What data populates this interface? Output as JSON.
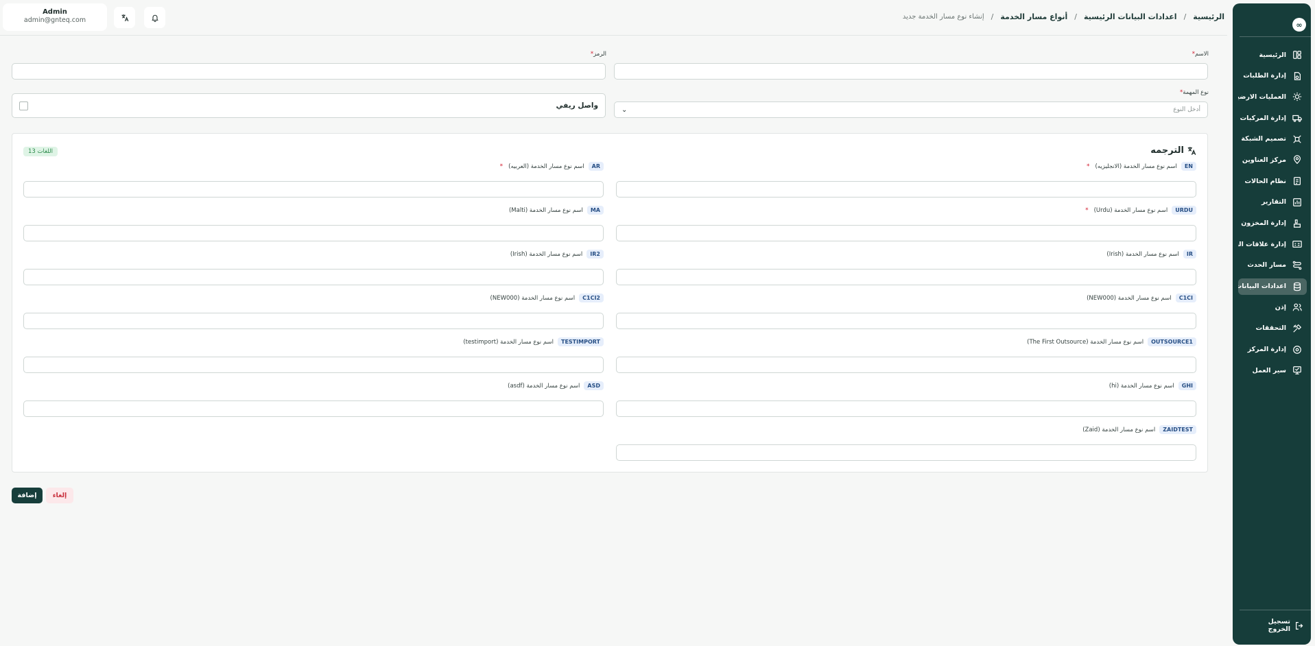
{
  "sidebar": {
    "logo": "∞",
    "items": [
      {
        "label": "الرئيسية",
        "icon": "layout-icon"
      },
      {
        "label": "إدارة الطلبات",
        "icon": "orders-icon"
      },
      {
        "label": "العمليات الارضية",
        "icon": "ground-ops-icon"
      },
      {
        "label": "إدارة المركبات",
        "icon": "truck-icon"
      },
      {
        "label": "تصميم الشبكة",
        "icon": "network-icon"
      },
      {
        "label": "مركز العناوين",
        "icon": "address-icon"
      },
      {
        "label": "نظام الحالات",
        "icon": "status-icon"
      },
      {
        "label": "التقارير",
        "icon": "reports-icon"
      },
      {
        "label": "إدارة المخزون",
        "icon": "inventory-icon"
      },
      {
        "label": "إدارة علاقات العملاء",
        "icon": "crm-icon"
      },
      {
        "label": "مسار الحدث",
        "icon": "route-icon"
      },
      {
        "label": "اعدادات البيانات",
        "icon": "database-icon",
        "active": true
      },
      {
        "label": "إذن",
        "icon": "users-icon"
      },
      {
        "label": "التحققات",
        "icon": "tools-icon"
      },
      {
        "label": "إدارة المركز",
        "icon": "center-icon"
      },
      {
        "label": "سير العمل",
        "icon": "workflow-icon"
      }
    ],
    "logout": "تسجيل الخروج"
  },
  "header": {
    "user_name": "Admin",
    "user_email": "admin@gnteq.com",
    "breadcrumb": [
      "الرئيسية",
      "اعدادات البيانات الرئيسية",
      "أنواع مسار الخدمة",
      "إنشاء نوع مسار الخدمة جديد"
    ]
  },
  "form": {
    "name_label": "الاسم",
    "code_label": "الرمز",
    "task_type_label": "نوع المهمة",
    "task_type_placeholder": "أدخل النوع",
    "checkbox_label": "واصل ريفي"
  },
  "translation": {
    "title": "الترجمه",
    "badge": "13 اللغات",
    "fields": [
      {
        "code": "EN",
        "label": "اسم نوع مسار الخدمة (الانجليزيه)",
        "required": true
      },
      {
        "code": "AR",
        "label": "اسم نوع مسار الخدمة (العربيه)",
        "required": true
      },
      {
        "code": "URDU",
        "label": "اسم نوع مسار الخدمة (Urdu)",
        "required": true
      },
      {
        "code": "MA",
        "label": "اسم نوع مسار الخدمة (Malti)",
        "required": false
      },
      {
        "code": "IR",
        "label": "اسم نوع مسار الخدمة (Irish)",
        "required": false
      },
      {
        "code": "IR2",
        "label": "اسم نوع مسار الخدمة (Irish)",
        "required": false
      },
      {
        "code": "C1CI",
        "label": "اسم نوع مسار الخدمة (NEW000)",
        "required": false
      },
      {
        "code": "C1CI2",
        "label": "اسم نوع مسار الخدمة (NEW000)",
        "required": false
      },
      {
        "code": "OUTSOURCE1",
        "label": "اسم نوع مسار الخدمة (The First Outsource)",
        "required": false
      },
      {
        "code": "TESTIMPORT",
        "label": "اسم نوع مسار الخدمة (testimport)",
        "required": false
      },
      {
        "code": "GHI",
        "label": "اسم نوع مسار الخدمة (hi)",
        "required": false
      },
      {
        "code": "ASD",
        "label": "اسم نوع مسار الخدمة (asdf)",
        "required": false
      },
      {
        "code": "ZAIDTEST",
        "label": "اسم نوع مسار الخدمة (Zaid)",
        "required": false
      }
    ]
  },
  "actions": {
    "add": "إضافة",
    "cancel": "إلغاء"
  },
  "required_mark": "*"
}
